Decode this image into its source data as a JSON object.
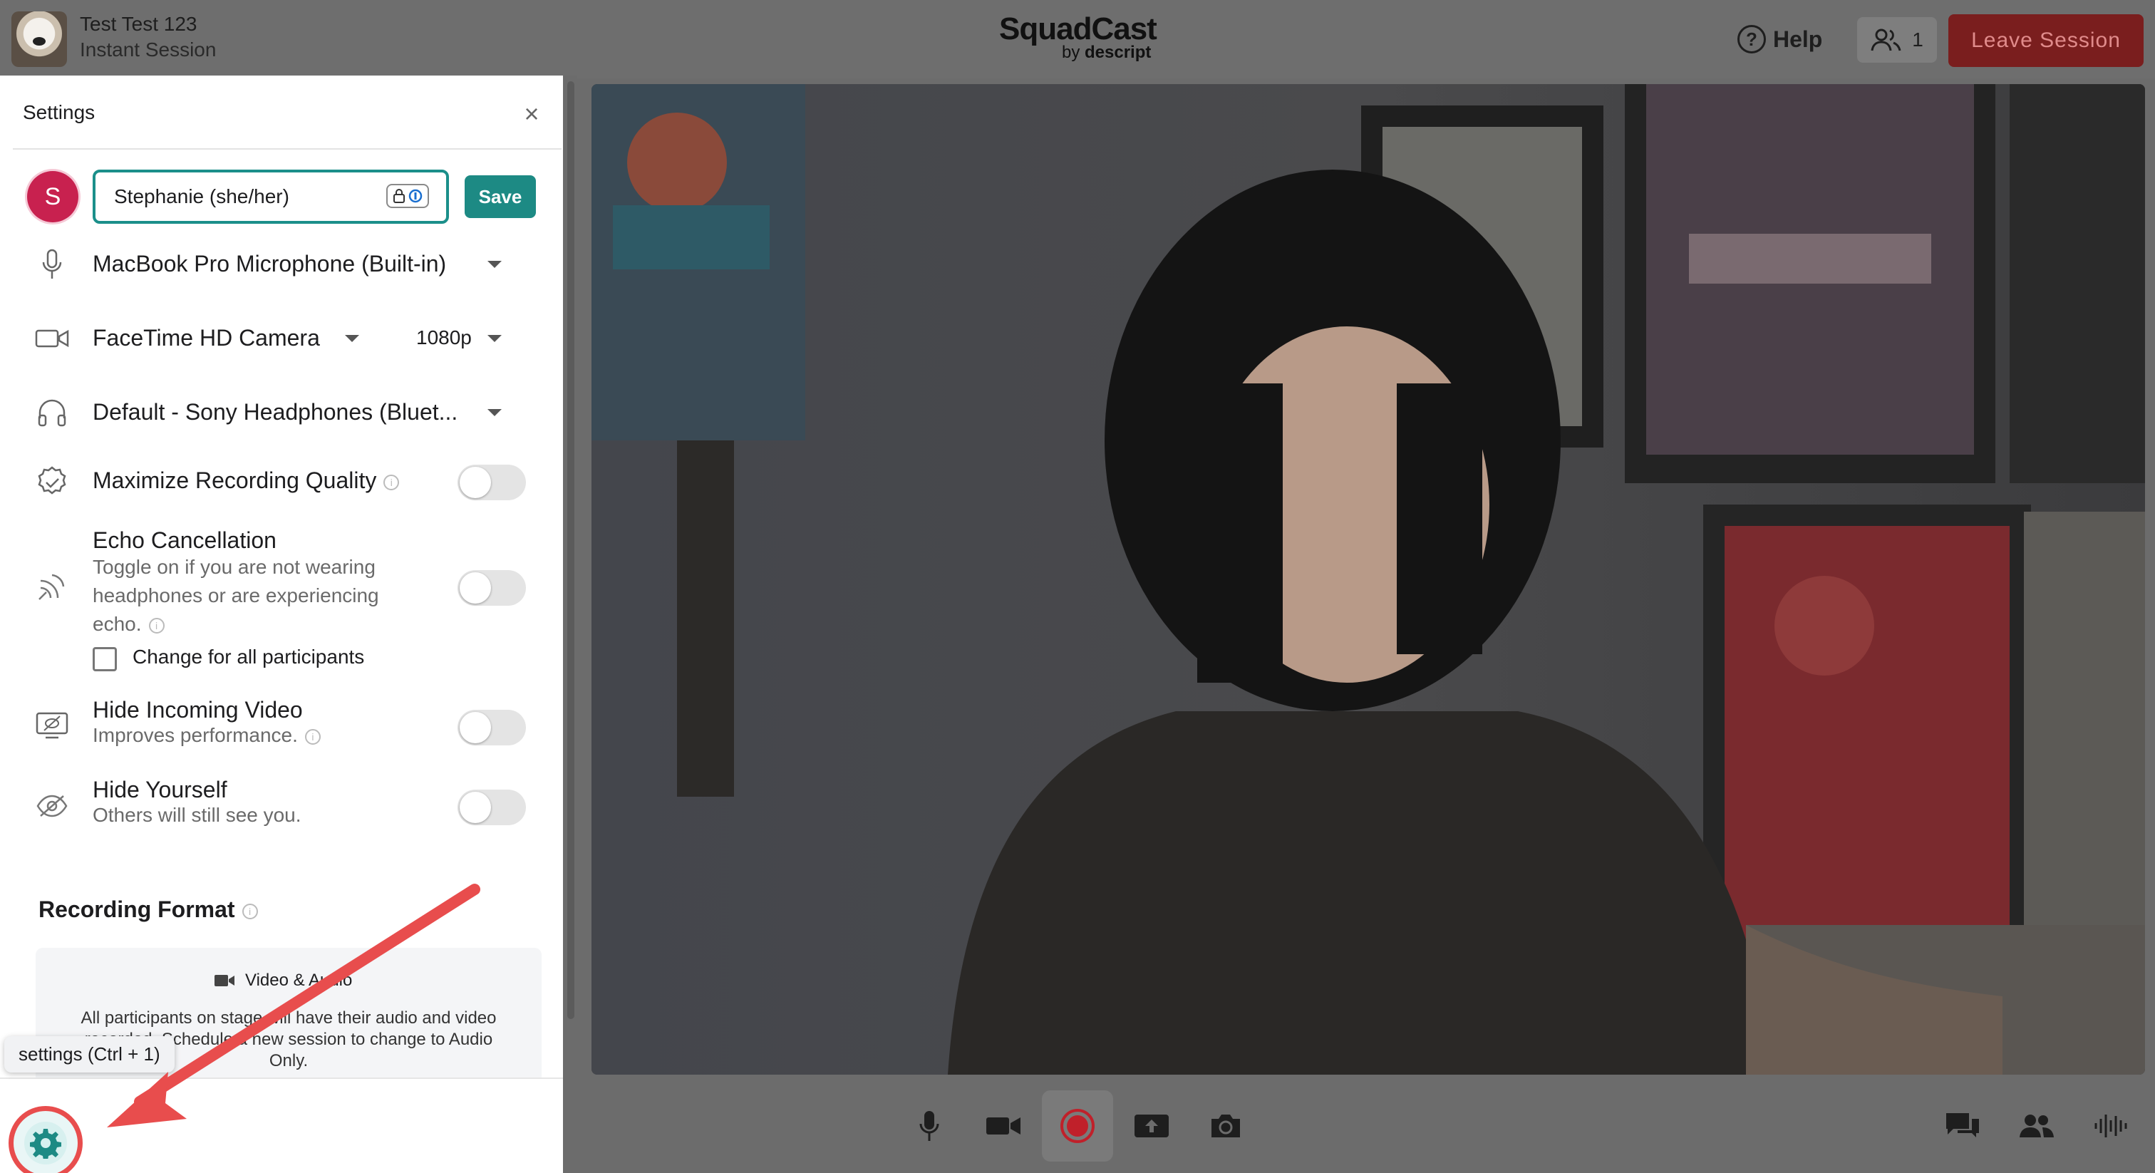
{
  "session": {
    "name": "Test Test 123",
    "type": "Instant Session"
  },
  "brand": {
    "name": "SquadCast",
    "sub_prefix": "by ",
    "sub_name": "descript"
  },
  "header": {
    "help_label": "Help",
    "participants_count": "1",
    "leave_label": "Leave Session"
  },
  "settings": {
    "title": "Settings",
    "user_initial": "S",
    "display_name": "Stephanie (she/her)",
    "save_label": "Save",
    "microphone": "MacBook Pro Microphone (Built-in)",
    "camera": "FaceTime HD Camera",
    "resolution": "1080p",
    "speaker": "Default - Sony Headphones (Bluet...",
    "max_quality_label": "Maximize Recording Quality",
    "echo_label": "Echo Cancellation",
    "echo_desc": "Toggle on if you are not wearing headphones or are experiencing echo.",
    "change_all_label": "Change for all participants",
    "hide_video_label": "Hide Incoming Video",
    "hide_video_desc": "Improves performance.",
    "hide_self_label": "Hide Yourself",
    "hide_self_desc": "Others will still see you.",
    "recording_format_title": "Recording Format",
    "format_mode": "Video & Audio",
    "format_desc": "All participants on stage will have their audio and video recorded. Schedule a new session to change to Audio Only."
  },
  "tooltip": "settings (Ctrl + 1)",
  "toggles": {
    "max_quality": false,
    "echo": false,
    "hide_video": false,
    "hide_self": false
  },
  "colors": {
    "accent": "#1d8a84",
    "leave": "#7a1e1e",
    "avatar": "#c8214f",
    "annotation": "#e84d4d"
  },
  "icons": [
    "microphone-icon",
    "camera-icon",
    "headphones-icon",
    "quality-badge-icon",
    "echo-icon",
    "hide-video-icon",
    "hide-self-icon",
    "gear-icon",
    "record-icon",
    "share-screen-icon",
    "snapshot-icon",
    "chat-icon",
    "people-icon",
    "audio-levels-icon"
  ]
}
